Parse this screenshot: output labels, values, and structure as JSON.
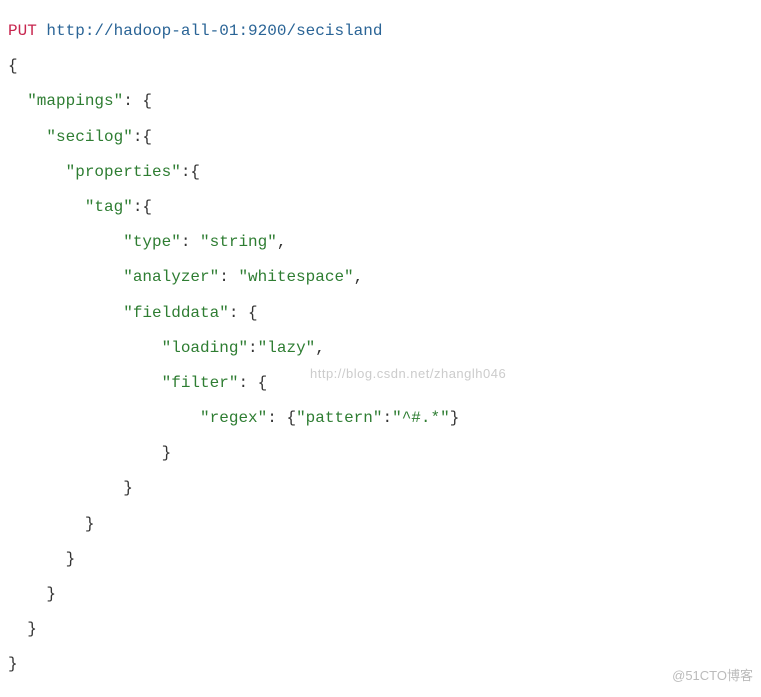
{
  "request": {
    "method": "PUT",
    "url": "http://hadoop-all-01:9200/secisland"
  },
  "code": {
    "l1": "{",
    "l2_key": "\"mappings\"",
    "l2_rest": ": {",
    "l3_key": "\"secilog\"",
    "l3_rest": ":{",
    "l4_key": "\"properties\"",
    "l4_rest": ":{",
    "l5_key": "\"tag\"",
    "l5_rest": ":{",
    "l6_key": "\"type\"",
    "l6_mid": ": ",
    "l6_val": "\"string\"",
    "l6_end": ",",
    "l7_key": "\"analyzer\"",
    "l7_mid": ": ",
    "l7_val": "\"whitespace\"",
    "l7_end": ",",
    "l8_key": "\"fielddata\"",
    "l8_rest": ": {",
    "l9_key": "\"loading\"",
    "l9_mid": ":",
    "l9_val": "\"lazy\"",
    "l9_end": ",",
    "l10_key": "\"filter\"",
    "l10_rest": ": {",
    "l11_key": "\"regex\"",
    "l11_mid": ": {",
    "l11_k2": "\"pattern\"",
    "l11_mid2": ":",
    "l11_val": "\"^#.*\"",
    "l11_end": "}",
    "l12": "}",
    "l13": "}",
    "l14": "}",
    "l15": "}",
    "l16": "}",
    "l17": "}",
    "l18": "}"
  },
  "watermarks": {
    "csdn": "http://blog.csdn.net/zhanglh046",
    "cto": "@51CTO博客"
  }
}
